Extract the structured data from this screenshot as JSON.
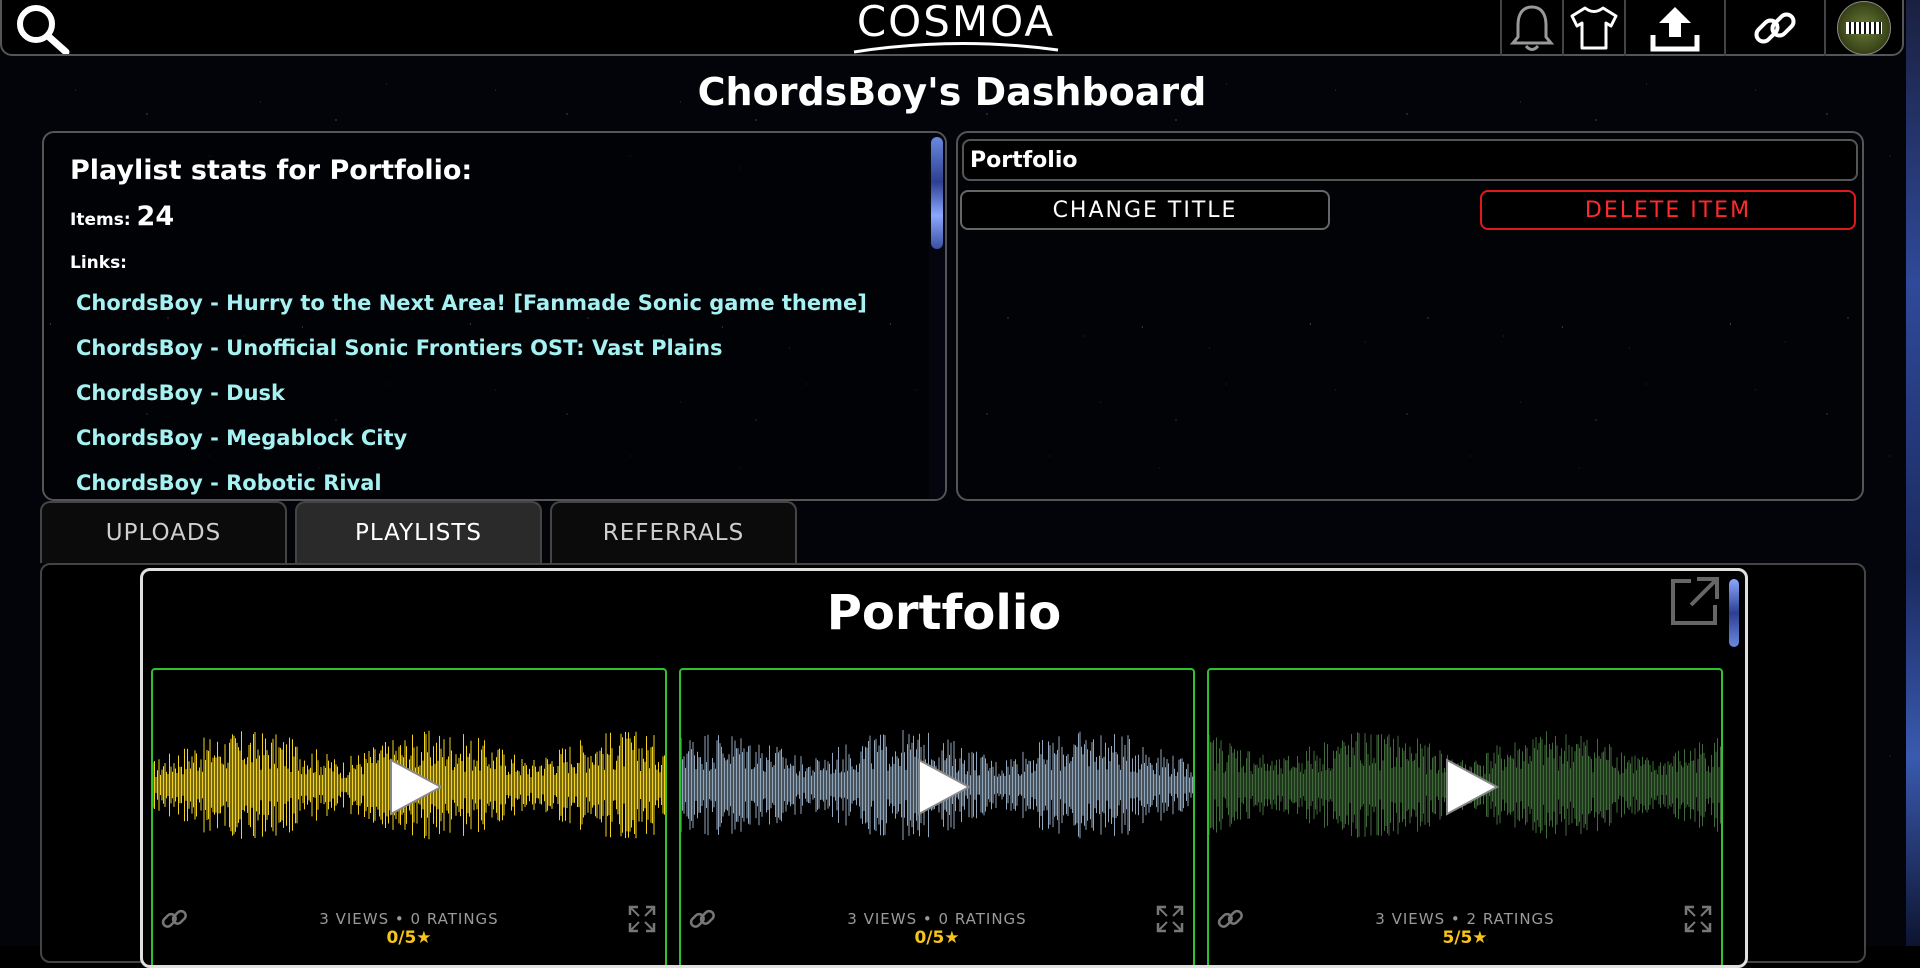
{
  "app": {
    "logo": "COSMOA"
  },
  "header": {
    "icons": [
      "search-icon",
      "bell-icon",
      "tshirt-icon",
      "upload-icon",
      "link-icon"
    ]
  },
  "page": {
    "title": "ChordsBoy's Dashboard"
  },
  "stats": {
    "heading": "Playlist stats for Portfolio:",
    "items_label": "Items:",
    "items_count": "24",
    "links_label": "Links:",
    "links": [
      "ChordsBoy - Hurry to the Next Area! [Fanmade Sonic game theme]",
      "ChordsBoy - Unofficial Sonic Frontiers OST: Vast Plains",
      "ChordsBoy - Dusk",
      "ChordsBoy - Megablock City",
      "ChordsBoy - Robotic Rival"
    ]
  },
  "edit": {
    "title_value": "Portfolio",
    "change_title_label": "CHANGE TITLE",
    "delete_label": "DELETE ITEM"
  },
  "tabs": [
    {
      "label": "UPLOADS",
      "active": false
    },
    {
      "label": "PLAYLISTS",
      "active": true
    },
    {
      "label": "REFERRALS",
      "active": false
    }
  ],
  "playlist": {
    "title": "Portfolio",
    "cards": [
      {
        "meta": "3 VIEWS • 0 RATINGS",
        "rating": "0/5★",
        "wave_color": "#f2d21b"
      },
      {
        "meta": "3 VIEWS • 0 RATINGS",
        "rating": "0/5★",
        "wave_color": "#8fa6bd"
      },
      {
        "meta": "3 VIEWS • 2 RATINGS",
        "rating": "5/5★",
        "wave_color": "#3f6b3a"
      }
    ]
  },
  "colors": {
    "link": "#a6f2f2",
    "delete": "#ff2a2a",
    "card_border": "#2ec22e",
    "rating": "#f5c518"
  }
}
